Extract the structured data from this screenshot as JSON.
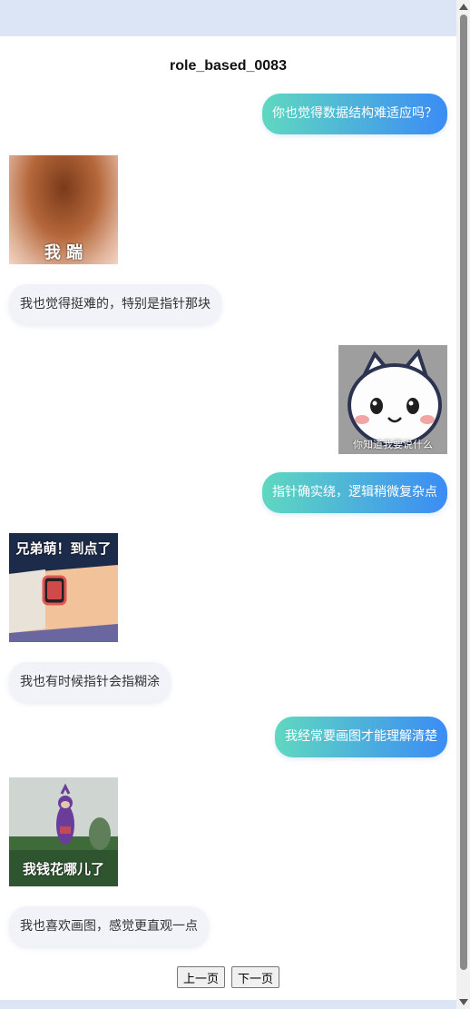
{
  "chat": {
    "title": "role_based_0083",
    "messages": [
      {
        "role": "user",
        "text": "你也觉得数据结构难适应吗？"
      },
      {
        "role": "bot",
        "sticker_caption": "我 踹"
      },
      {
        "role": "bot",
        "text": "我也觉得挺难的，特别是指针那块"
      },
      {
        "role": "user",
        "sticker_caption": "你知道我要说什么"
      },
      {
        "role": "user",
        "text": "指针确实绕，逻辑稍微复杂点"
      },
      {
        "role": "bot",
        "sticker_caption": "兄弟萌！到点了"
      },
      {
        "role": "bot",
        "text": "我也有时候指针会指糊涂"
      },
      {
        "role": "user",
        "text": "我经常要画图才能理解清楚"
      },
      {
        "role": "bot",
        "sticker_caption": "我钱花哪儿了"
      },
      {
        "role": "bot",
        "text": "我也喜欢画图，感觉更直观一点"
      }
    ]
  },
  "pager": {
    "prev_label": "上一页",
    "next_label": "下一页"
  },
  "colors": {
    "user_gradient_start": "#5fd8c0",
    "user_gradient_end": "#3b8cf5",
    "bot_bubble": "#f1f3f8"
  }
}
